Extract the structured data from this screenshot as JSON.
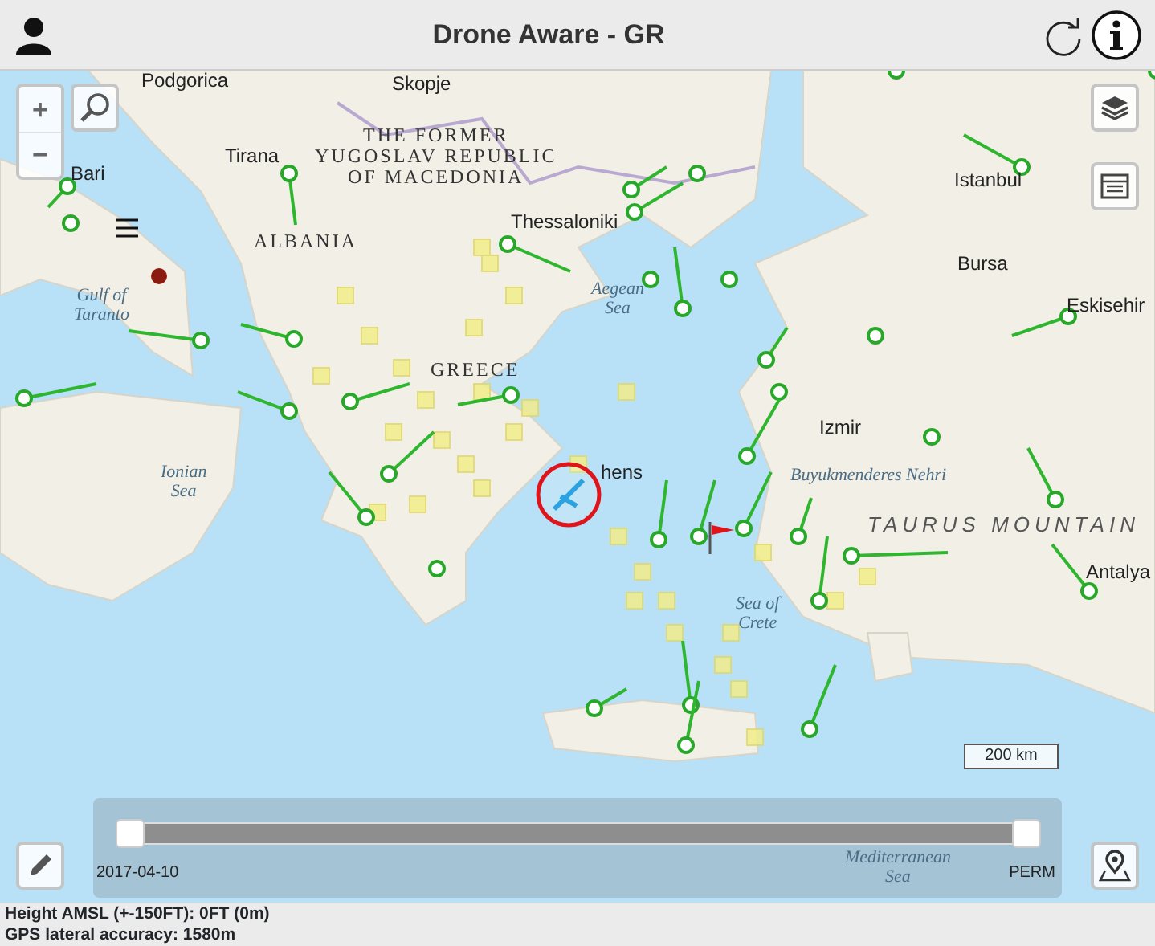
{
  "header": {
    "title": "Drone Aware - GR"
  },
  "map_labels": [
    {
      "text": "Podgorica",
      "kind": "city"
    },
    {
      "text": "Skopje",
      "kind": "city"
    },
    {
      "text": "Bari",
      "kind": "city"
    },
    {
      "text": "Tirana",
      "kind": "city"
    },
    {
      "text": "THE FORMER\nYUGOSLAV REPUBLIC\nOF MACEDONIA",
      "kind": "country"
    },
    {
      "text": "ALBANIA",
      "kind": "country"
    },
    {
      "text": "Gulf of\nTaranto",
      "kind": "water"
    },
    {
      "text": "Thessaloniki",
      "kind": "city"
    },
    {
      "text": "Istanbul",
      "kind": "city"
    },
    {
      "text": "Bursa",
      "kind": "city"
    },
    {
      "text": "Eskisehir",
      "kind": "city"
    },
    {
      "text": "GREECE",
      "kind": "country"
    },
    {
      "text": "Aegean\nSea",
      "kind": "water"
    },
    {
      "text": "Izmir",
      "kind": "city"
    },
    {
      "text": "Ionian\nSea",
      "kind": "water"
    },
    {
      "text": "hens",
      "kind": "city"
    },
    {
      "text": "Buyukmenderes Nehri",
      "kind": "river"
    },
    {
      "text": "TAURUS MOUNTAIN",
      "kind": "region"
    },
    {
      "text": "Antalya",
      "kind": "city"
    },
    {
      "text": "Sea of\nCrete",
      "kind": "water"
    },
    {
      "text": "Mediterranean\nSea",
      "kind": "water"
    }
  ],
  "map_controls": {
    "zoom_in": "+",
    "zoom_out": "−"
  },
  "scale_bar": {
    "label": "200 km"
  },
  "timeline": {
    "start": "2017-04-10",
    "end": "PERM",
    "level": 1
  },
  "status_bar": {
    "lines": [
      "Height AMSL (+-150FT): 0FT (0m)",
      "GPS lateral accuracy: 1580m"
    ]
  }
}
